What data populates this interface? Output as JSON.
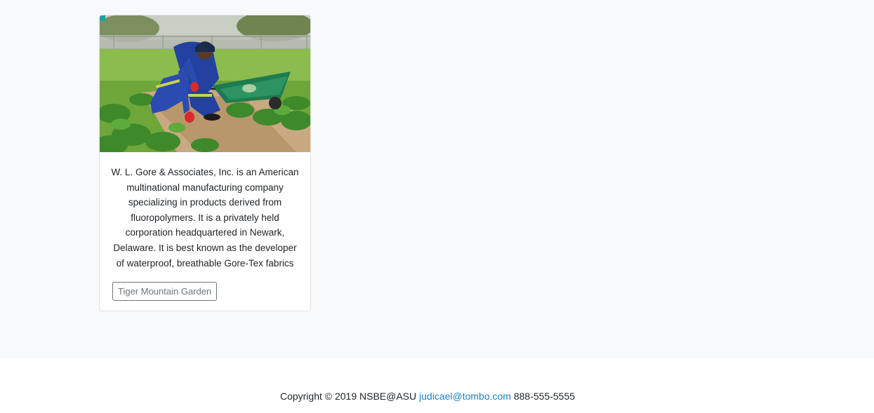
{
  "card": {
    "image_alt": "person working in a vegetable garden with a green wheelbarrow",
    "description": "W. L. Gore & Associates, Inc. is an American multinational manufacturing company specializing in products derived from fluoropolymers. It is a privately held corporation headquartered in Newark, Delaware. It is best known as the developer of waterproof, breathable Gore-Tex fabrics",
    "button_label": "Tiger Mountain Garden"
  },
  "footer": {
    "copyright": "Copyright © 2019 NSBE@ASU",
    "email": "judicael@tombo.com",
    "phone": "888-555-5555"
  },
  "colors": {
    "background": "#f8f9fa",
    "link": "#1f7ec0",
    "button_border": "#6c757d"
  }
}
